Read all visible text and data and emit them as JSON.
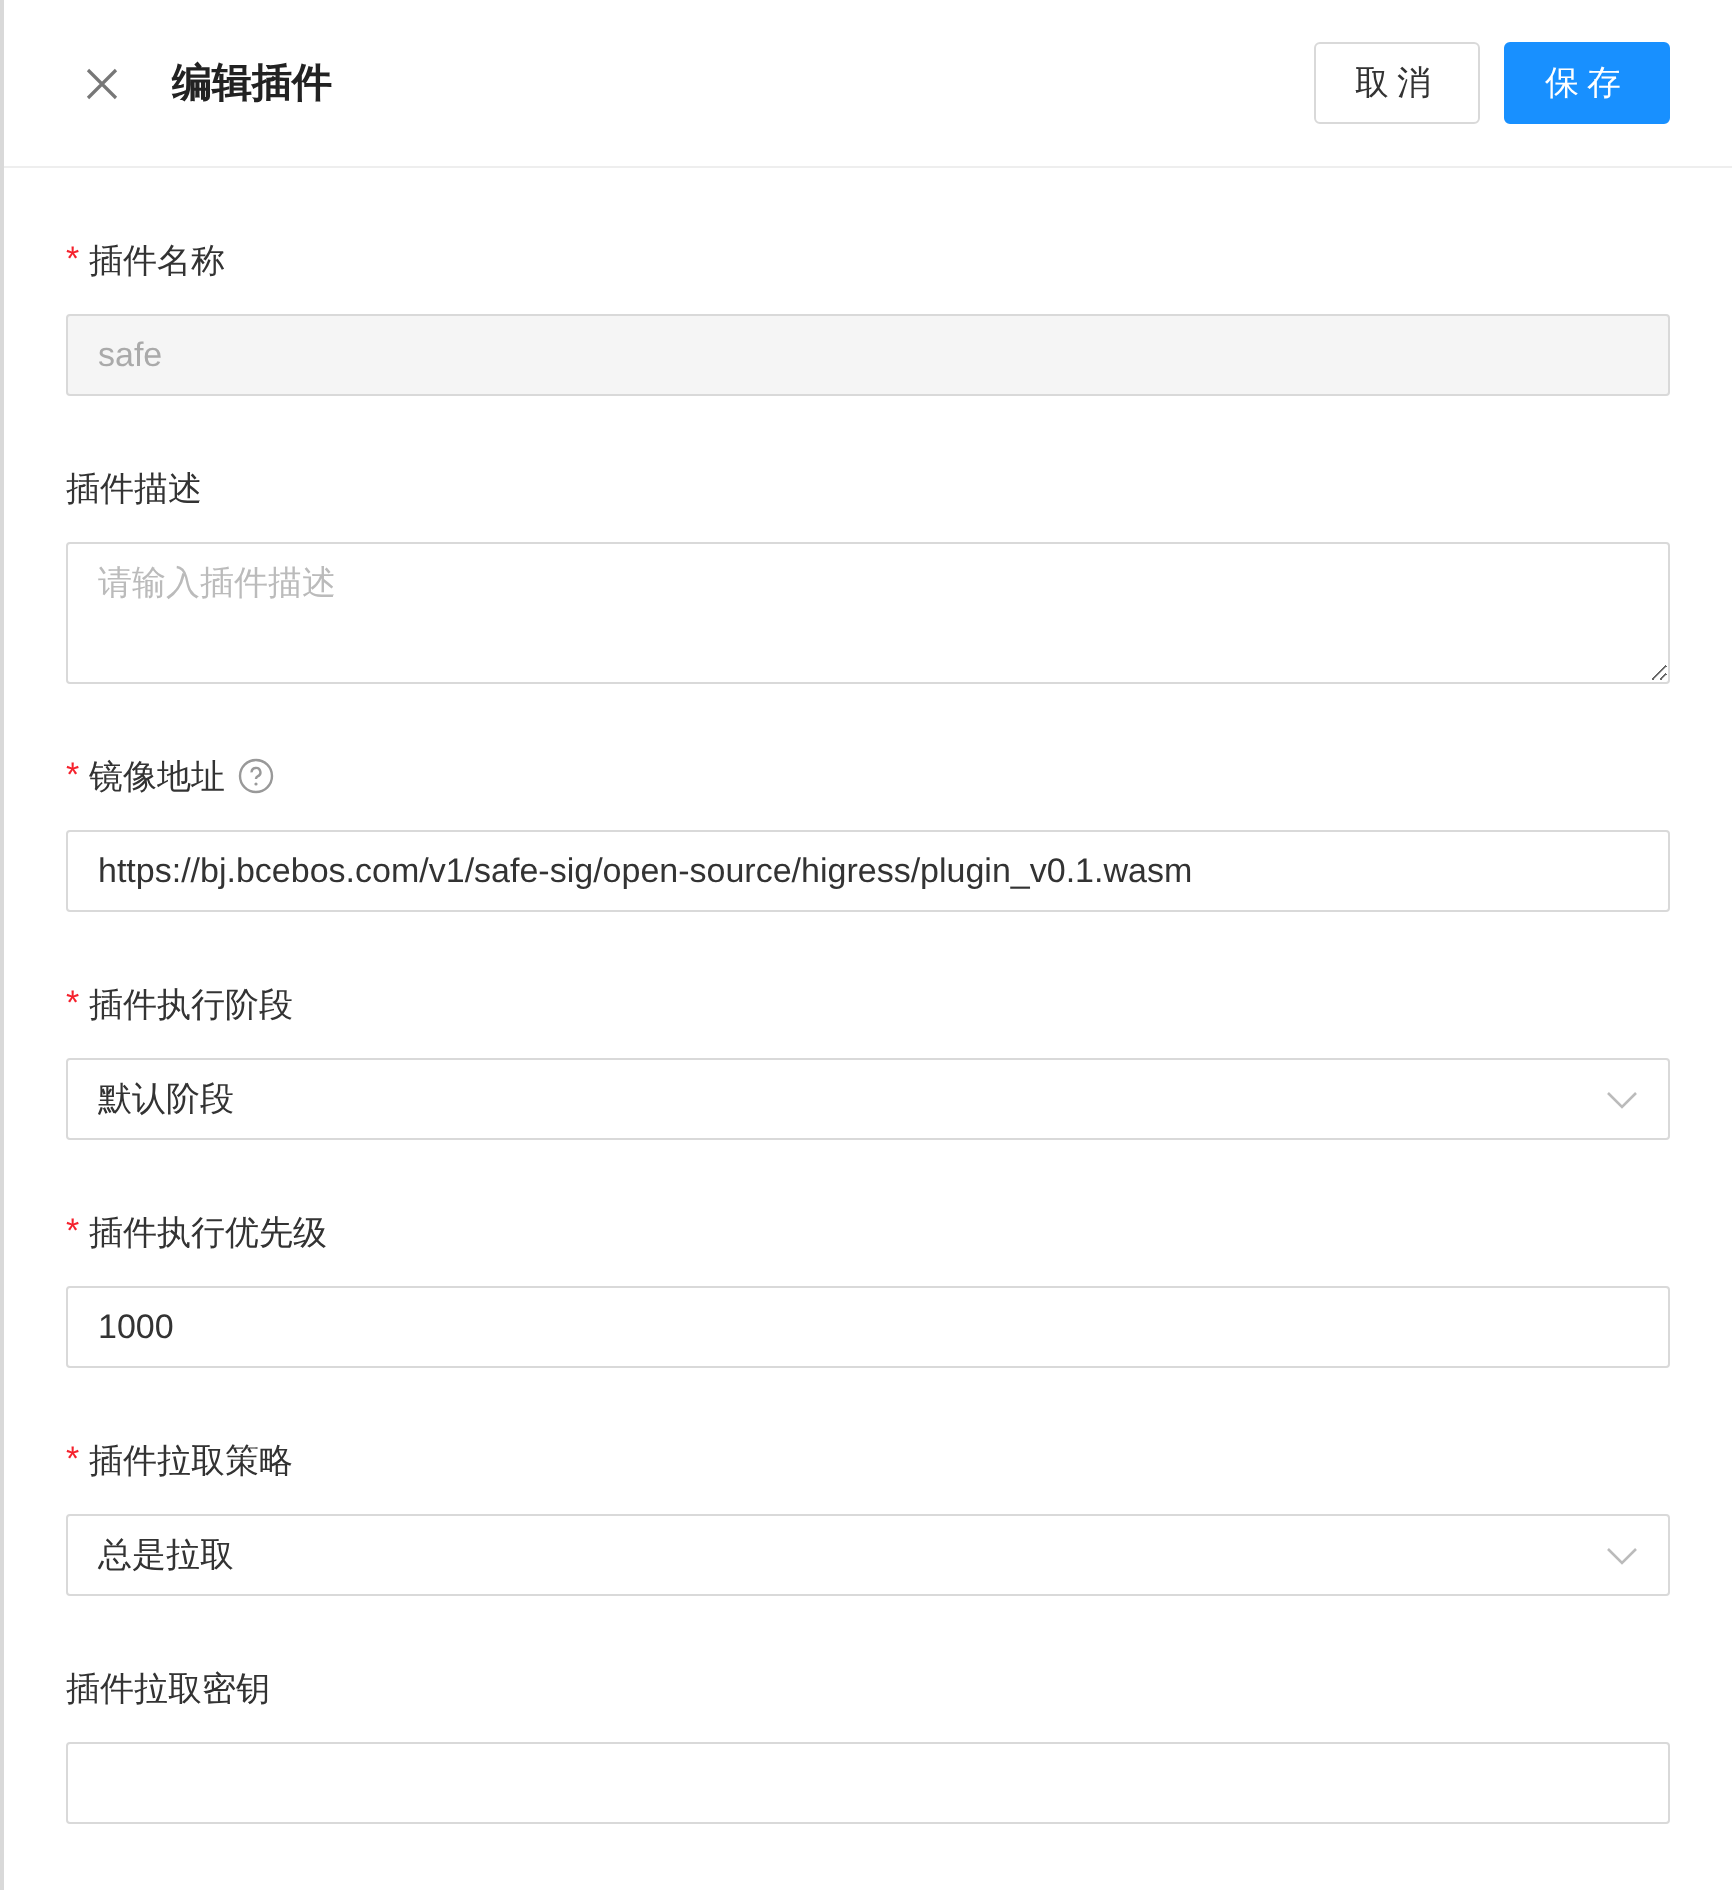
{
  "header": {
    "title": "编辑插件",
    "buttons": [
      {
        "label": "取消",
        "kind": "default"
      },
      {
        "label": "保存",
        "kind": "primary"
      }
    ]
  },
  "fields": [
    {
      "mark": "*",
      "label": "插件名称",
      "kind": "input",
      "value": "safe",
      "disabled": true
    },
    {
      "label": "插件描述",
      "kind": "textarea",
      "placeholder": "请输入插件描述"
    },
    {
      "mark": "*",
      "label": "镜像地址",
      "help": true,
      "kind": "input",
      "value": "https://bj.bcebos.com/v1/safe-sig/open-source/higress/plugin_v0.1.wasm"
    },
    {
      "mark": "*",
      "label": "插件执行阶段",
      "kind": "select",
      "value": "默认阶段"
    },
    {
      "mark": "*",
      "label": "插件执行优先级",
      "kind": "input",
      "value": "1000"
    },
    {
      "mark": "*",
      "label": "插件拉取策略",
      "kind": "select",
      "value": "总是拉取"
    },
    {
      "label": "插件拉取密钥",
      "kind": "input"
    }
  ]
}
